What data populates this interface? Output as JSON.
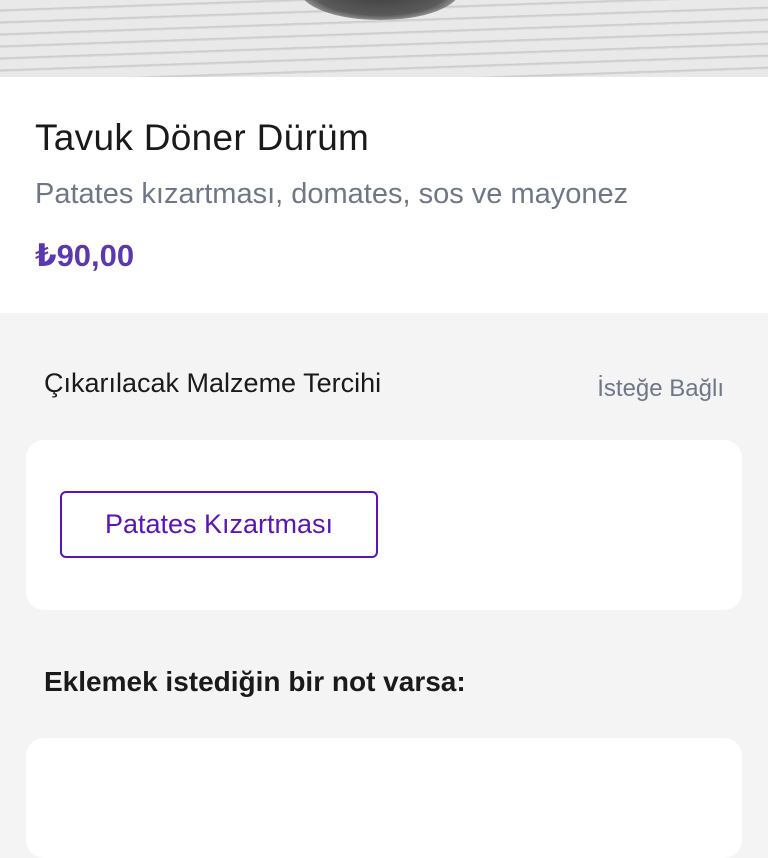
{
  "product": {
    "title": "Tavuk Döner Dürüm",
    "description": "Patates kızartması, domates, sos ve mayonez",
    "price": "₺90,00"
  },
  "removal_section": {
    "title": "Çıkarılacak Malzeme Tercihi",
    "optional_label": "İsteğe Bağlı",
    "options": [
      "Patates Kızartması"
    ]
  },
  "note_section": {
    "title": "Eklemek istediğin bir not varsa:"
  },
  "colors": {
    "accent": "#5b14b8",
    "price": "#5a38b0",
    "muted_text": "#6f7787",
    "background": "#f4f4f5"
  }
}
